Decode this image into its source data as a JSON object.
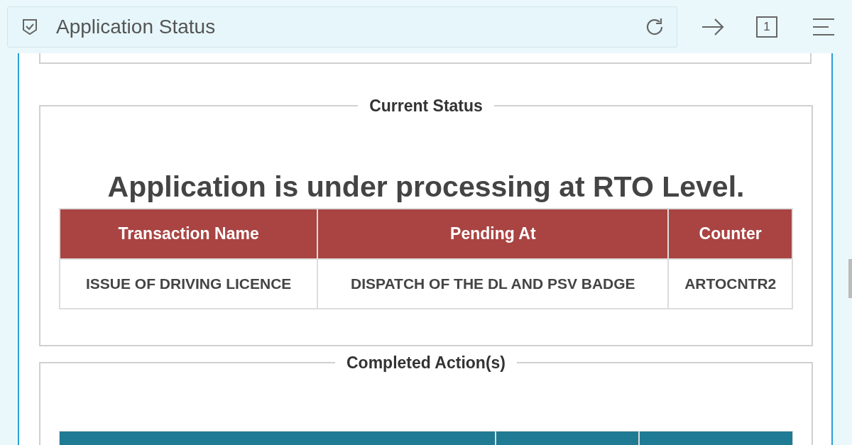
{
  "browser": {
    "title": "Application Status",
    "tab_count": "1"
  },
  "current_status": {
    "legend": "Current Status",
    "message": "Application is under processing at RTO Level.",
    "table": {
      "columns": [
        "Transaction Name",
        "Pending At",
        "Counter"
      ],
      "rows": [
        [
          "ISSUE OF DRIVING LICENCE",
          "DISPATCH OF THE DL AND PSV BADGE",
          "ARTOCNTR2"
        ]
      ]
    }
  },
  "completed_actions": {
    "legend": "Completed Action(s)"
  }
}
